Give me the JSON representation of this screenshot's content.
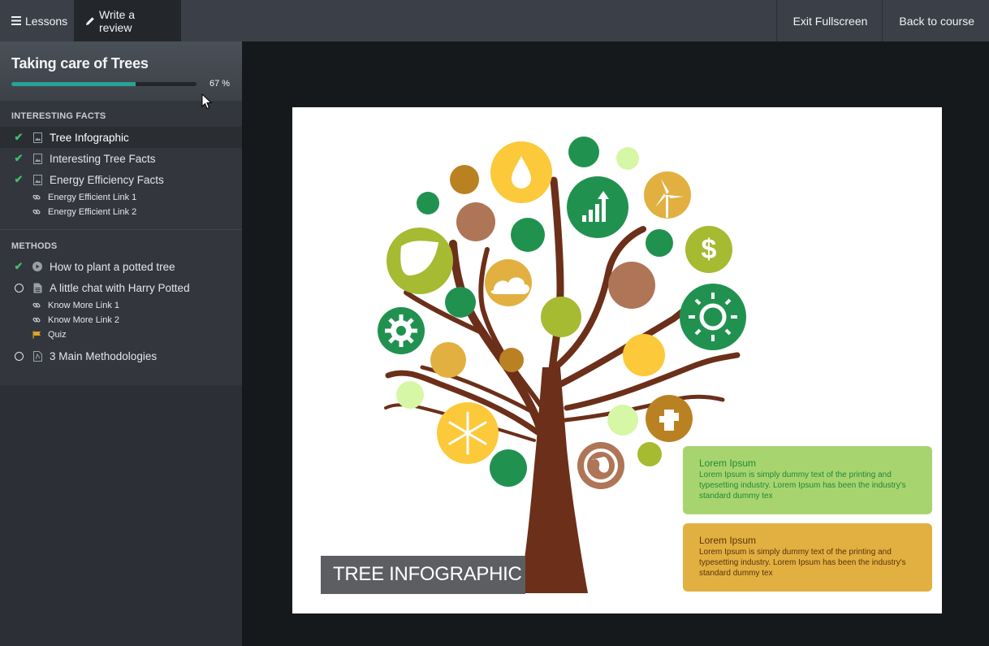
{
  "topbar": {
    "lessons_label": "Lessons",
    "review_label": "Write a review",
    "exit_label": "Exit Fullscreen",
    "back_label": "Back to course"
  },
  "course": {
    "title": "Taking care of Trees",
    "progress": 0.67,
    "progress_label": "67 %"
  },
  "sections": [
    {
      "title": "INTERESTING FACTS",
      "items": [
        {
          "label": "Tree Infographic",
          "status": "done",
          "type": "image-icon"
        },
        {
          "label": "Interesting Tree Facts",
          "status": "done",
          "type": "image-icon"
        },
        {
          "label": "Energy Efficiency Facts",
          "status": "done",
          "type": "image-icon"
        }
      ],
      "links": [
        "Energy Efficient Link 1",
        "Energy Efficient Link 2"
      ]
    },
    {
      "title": "METHODS",
      "items": [
        {
          "label": "How to plant a potted tree",
          "status": "done",
          "type": "play-icon"
        },
        {
          "label": "A little chat with Harry Potted",
          "status": "todo",
          "type": "document-icon"
        },
        {
          "label": "3 Main Methodologies",
          "status": "todo",
          "type": "pdf-icon"
        }
      ],
      "links": [
        "Know More Link 1",
        "Know More Link 2"
      ],
      "quiz_label": "Quiz"
    }
  ],
  "slide": {
    "label": "TREE INFOGRAPHIC",
    "box1": {
      "title": "Lorem Ipsum",
      "text": "Lorem Ipsum is simply dummy text of the printing and typesetting industry. Lorem Ipsum has been the industry's standard dummy tex"
    },
    "box2": {
      "title": "Lorem Ipsum",
      "text": "Lorem Ipsum is simply dummy text of the printing and typesetting industry. Lorem Ipsum has been the industry's standard dummy tex"
    }
  },
  "colors": {
    "accent_teal": "#2aa198",
    "check_green": "#3fbf6a",
    "tree_brown": "#6b2f1a",
    "box_green": "#a8d46f",
    "box_gold": "#e2b040"
  }
}
